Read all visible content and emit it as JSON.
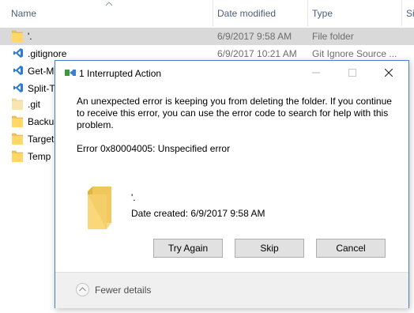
{
  "explorer": {
    "columns": {
      "name": "Name",
      "date": "Date modified",
      "type": "Type",
      "size": "Si"
    },
    "rows": [
      {
        "name": "'.",
        "date": "6/9/2017 9:58 AM",
        "type": "File folder",
        "icon": "folder-icon"
      },
      {
        "name": ".gitignore",
        "date": "6/9/2017 10:21 AM",
        "type": "Git Ignore Source ...",
        "icon": "vscode-file-icon"
      },
      {
        "name": "Get-M",
        "icon": "vscode-file-icon"
      },
      {
        "name": "Split-T",
        "icon": "vscode-file-icon"
      },
      {
        "name": ".git",
        "icon": "folder-icon"
      },
      {
        "name": "Backup",
        "icon": "folder-icon"
      },
      {
        "name": "Target",
        "icon": "folder-icon"
      },
      {
        "name": "Temp",
        "icon": "folder-icon"
      }
    ]
  },
  "dialog": {
    "title": "1 Interrupted Action",
    "message": "An unexpected error is keeping you from deleting the folder. If you continue to receive this error, you can use the error code to search for help with this problem.",
    "error": "Error 0x80004005: Unspecified error",
    "item_name": "'.",
    "item_date": "Date created: 6/9/2017 9:58 AM",
    "buttons": {
      "try_again": "Try Again",
      "skip": "Skip",
      "cancel": "Cancel"
    },
    "fewer_details": "Fewer details"
  },
  "colors": {
    "folder": "#e8c55a",
    "selection": "#d9d9d9",
    "dialog_border": "#4a7fc8",
    "vscode_blue": "#2a7bd4",
    "header_text": "#4c607a"
  }
}
